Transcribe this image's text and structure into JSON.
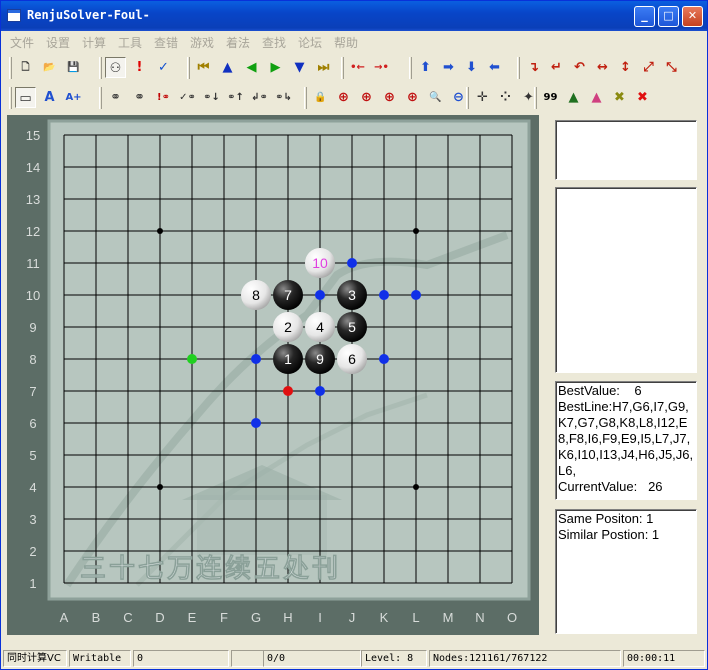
{
  "window": {
    "title": "RenjuSolver-Foul-",
    "minimize": "_",
    "maximize": "□",
    "close": "✕"
  },
  "menu": [
    "文件",
    "设置",
    "计算",
    "工具",
    "查错",
    "游戏",
    "着法",
    "查找",
    "论坛",
    "帮助"
  ],
  "toolbar1": [
    {
      "name": "new-icon",
      "glyph": "🗋"
    },
    {
      "name": "open-folder-icon",
      "glyph": "📂"
    },
    {
      "name": "save-icon",
      "glyph": "💾"
    },
    {
      "name": "stones-icon",
      "glyph": "⚇"
    },
    {
      "name": "exclamation-icon",
      "glyph": "!"
    },
    {
      "name": "check-icon",
      "glyph": "✓"
    },
    {
      "name": "first-move-icon",
      "glyph": "⏮"
    },
    {
      "name": "up-triangle-icon",
      "glyph": "▲"
    },
    {
      "name": "back-icon",
      "glyph": "◀"
    },
    {
      "name": "forward-icon",
      "glyph": "▶"
    },
    {
      "name": "down-triangle-icon",
      "glyph": "▼"
    },
    {
      "name": "last-move-icon",
      "glyph": "⏭"
    },
    {
      "name": "insert-left-icon",
      "glyph": "•←"
    },
    {
      "name": "insert-right-icon",
      "glyph": "→•"
    },
    {
      "name": "shift-up-icon",
      "glyph": "⬆"
    },
    {
      "name": "shift-right-icon",
      "glyph": "➡"
    },
    {
      "name": "shift-down-icon",
      "glyph": "⬇"
    },
    {
      "name": "shift-left-icon",
      "glyph": "⬅"
    },
    {
      "name": "rotate-cw-icon",
      "glyph": "↴"
    },
    {
      "name": "rotate-ccw-icon",
      "glyph": "↵"
    },
    {
      "name": "rotate-180-icon",
      "glyph": "↶"
    },
    {
      "name": "flip-horizontal-icon",
      "glyph": "↔"
    },
    {
      "name": "flip-vertical-icon",
      "glyph": "↕"
    },
    {
      "name": "flip-diagonal-icon",
      "glyph": "⤢"
    },
    {
      "name": "flip-antidiagonal-icon",
      "glyph": "⤡"
    }
  ],
  "toolbar2": [
    {
      "name": "text-box-icon",
      "glyph": "▭"
    },
    {
      "name": "font-a-icon",
      "glyph": "A"
    },
    {
      "name": "font-a-plus-icon",
      "glyph": "A+"
    },
    {
      "name": "search-vcf-icon",
      "glyph": "⚭"
    },
    {
      "name": "search-vct-icon",
      "glyph": "⚭"
    },
    {
      "name": "search-foul-icon",
      "glyph": "!⚭"
    },
    {
      "name": "search-check-icon",
      "glyph": "✓⚭"
    },
    {
      "name": "search-down-icon",
      "glyph": "⚭↓"
    },
    {
      "name": "search-up-icon",
      "glyph": "⚭↑"
    },
    {
      "name": "search-back-icon",
      "glyph": "↲⚭"
    },
    {
      "name": "search-forward-icon",
      "glyph": "⚭↳"
    },
    {
      "name": "lock-icon",
      "glyph": "🔒"
    },
    {
      "name": "zoom-a-icon",
      "glyph": "⊕"
    },
    {
      "name": "zoom-b-icon",
      "glyph": "⊕"
    },
    {
      "name": "zoom-c-icon",
      "glyph": "⊕"
    },
    {
      "name": "zoom-d-icon",
      "glyph": "⊕"
    },
    {
      "name": "zoom-in-icon",
      "glyph": "🔍"
    },
    {
      "name": "zoom-out-icon",
      "glyph": "⊖"
    },
    {
      "name": "crosshair-icon",
      "glyph": "✛"
    },
    {
      "name": "dotted-cross-icon",
      "glyph": "⁘"
    },
    {
      "name": "target-icon",
      "glyph": "✦"
    },
    {
      "name": "move-number-icon",
      "glyph": "99"
    },
    {
      "name": "tree-icon",
      "glyph": "▲"
    },
    {
      "name": "tree-color-icon",
      "glyph": "▲"
    },
    {
      "name": "clear-olive-icon",
      "glyph": "✖"
    },
    {
      "name": "clear-red-icon",
      "glyph": "✖"
    }
  ],
  "board": {
    "columns": [
      "A",
      "B",
      "C",
      "D",
      "E",
      "F",
      "G",
      "H",
      "I",
      "J",
      "K",
      "L",
      "M",
      "N",
      "O"
    ],
    "rows": [
      "15",
      "14",
      "13",
      "12",
      "11",
      "10",
      "9",
      "8",
      "7",
      "6",
      "5",
      "4",
      "3",
      "2",
      "1"
    ],
    "watermark": "三十七万连续五处刊",
    "star_points": [
      "D12",
      "L12",
      "D4",
      "L4"
    ],
    "stones": [
      {
        "pos": "H8",
        "color": "black",
        "label": "1"
      },
      {
        "pos": "H9",
        "color": "white",
        "label": "2"
      },
      {
        "pos": "J10",
        "color": "black",
        "label": "3"
      },
      {
        "pos": "I9",
        "color": "white",
        "label": "4"
      },
      {
        "pos": "J9",
        "color": "black",
        "label": "5"
      },
      {
        "pos": "J8",
        "color": "white",
        "label": "6"
      },
      {
        "pos": "H10",
        "color": "black",
        "label": "7"
      },
      {
        "pos": "G10",
        "color": "white",
        "label": "8"
      },
      {
        "pos": "I8",
        "color": "black",
        "label": "9"
      },
      {
        "pos": "I11",
        "color": "white",
        "label": "10",
        "highlight": true
      }
    ],
    "markers": [
      {
        "pos": "J11",
        "color": "#1030e8"
      },
      {
        "pos": "I10",
        "color": "#1030e8"
      },
      {
        "pos": "K10",
        "color": "#1030e8"
      },
      {
        "pos": "L10",
        "color": "#1030e8"
      },
      {
        "pos": "G8",
        "color": "#1030e8"
      },
      {
        "pos": "K8",
        "color": "#1030e8"
      },
      {
        "pos": "I7",
        "color": "#1030e8"
      },
      {
        "pos": "G6",
        "color": "#1030e8"
      },
      {
        "pos": "H7",
        "color": "#e01010"
      },
      {
        "pos": "E8",
        "color": "#20d020"
      }
    ]
  },
  "panel_info": {
    "text": "BestValue:    6\nBestLine:H7,G6,I7,G9,K7,G7,G8,K8,L8,I12,E8,F8,I6,F9,E9,I5,L7,J7,K6,I10,I13,J4,H6,J5,J6,L6,\nCurrentValue:   26"
  },
  "panel_position": {
    "text": "Same Positon: 1\nSimilar Postion: 1"
  },
  "status": {
    "mode": "同时计算VC",
    "writable": "Writable",
    "value": "0",
    "ratio": "0/0",
    "level": "Level: 8",
    "nodes": "Nodes:121161/767122",
    "time": "00:00:11"
  }
}
